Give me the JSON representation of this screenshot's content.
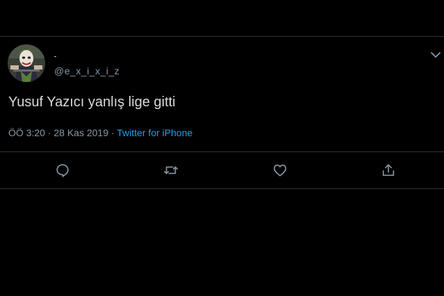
{
  "tweet": {
    "display_name": "-",
    "handle": "@e_x_i_x_i_z",
    "text": "Yusuf Yazıcı yanlış lige gitti",
    "time": "ÖÖ 3:20",
    "separator": "·",
    "date": "28 Kas 2019",
    "source": "Twitter for iPhone"
  },
  "icons": {
    "avatar": "joker-avatar",
    "caret": "chevron-down-icon",
    "reply": "reply-icon",
    "retweet": "retweet-icon",
    "like": "heart-icon",
    "share": "share-icon"
  },
  "colors": {
    "background": "#000000",
    "text": "#d9d9d9",
    "secondary": "#8899a6",
    "link": "#1da1f2",
    "divider": "#2f3336"
  }
}
